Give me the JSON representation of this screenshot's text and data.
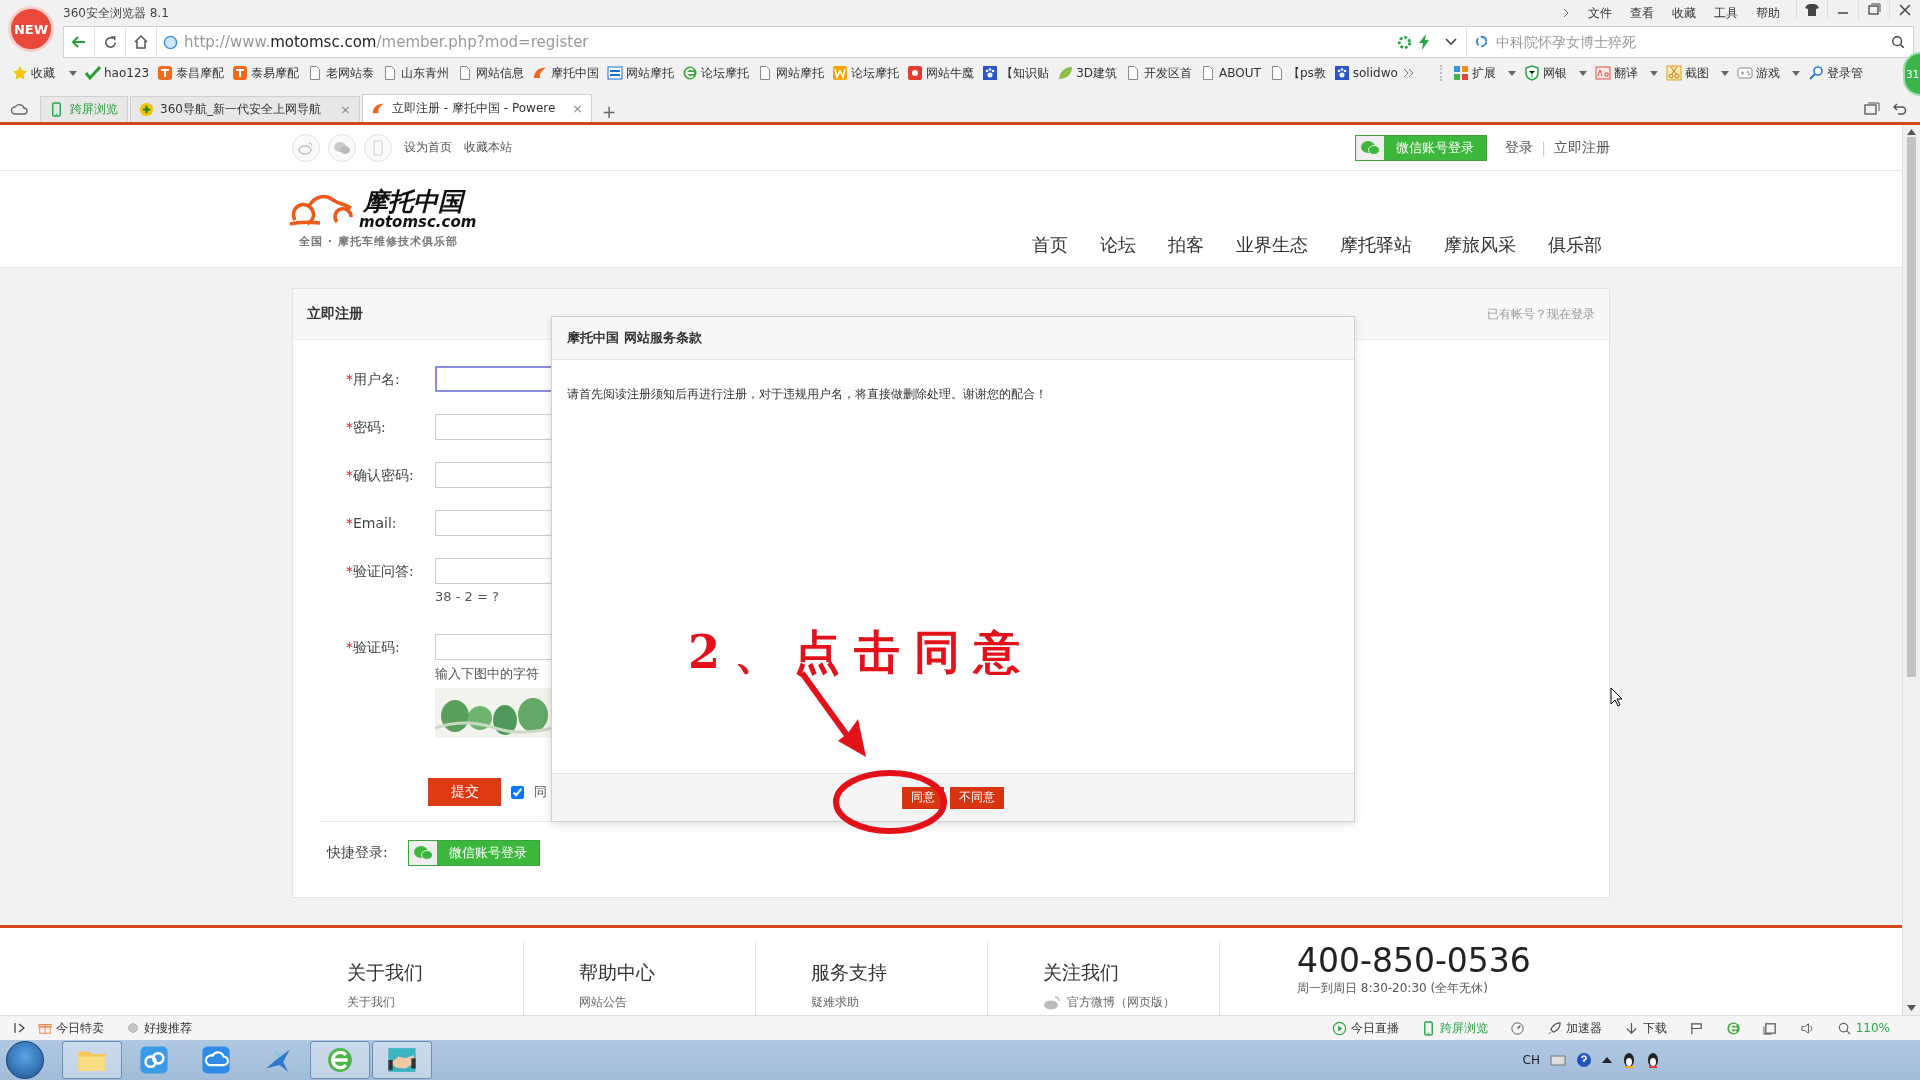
{
  "browser": {
    "badge": "NEW",
    "title": "360安全浏览器 8.1",
    "menu": [
      "文件",
      "查看",
      "收藏",
      "工具",
      "帮助"
    ],
    "url": {
      "prefix": "http://www.",
      "domain": "motomsc.com",
      "path": "/member.php?mod=register"
    },
    "search": {
      "placeholder": "中科院怀孕女博士猝死"
    },
    "bookmarks": [
      {
        "label": "收藏",
        "kind": "star",
        "caret": true
      },
      {
        "label": "hao123",
        "kind": "hao",
        "caret": false
      },
      {
        "label": "泰昌摩配",
        "kind": "tao",
        "caret": false
      },
      {
        "label": "泰易摩配",
        "kind": "tao",
        "caret": false
      },
      {
        "label": "老网站泰",
        "kind": "page",
        "caret": false
      },
      {
        "label": "山东青州",
        "kind": "page",
        "caret": false
      },
      {
        "label": "网站信息",
        "kind": "page",
        "caret": false
      },
      {
        "label": "摩托中国",
        "kind": "moto",
        "caret": false
      },
      {
        "label": "网站摩托",
        "kind": "mi",
        "caret": false
      },
      {
        "label": "论坛摩托",
        "kind": "ie",
        "caret": false
      },
      {
        "label": "网站摩托",
        "kind": "page",
        "caret": false
      },
      {
        "label": "论坛摩托",
        "kind": "w",
        "caret": false
      },
      {
        "label": "网站牛魔",
        "kind": "red",
        "caret": false
      },
      {
        "label": "【知识贴",
        "kind": "paw",
        "caret": false
      },
      {
        "label": "3D建筑",
        "kind": "leaf",
        "caret": false
      },
      {
        "label": "开发区首",
        "kind": "page",
        "caret": false
      },
      {
        "label": "ABOUT",
        "kind": "page",
        "caret": false
      },
      {
        "label": "【ps教",
        "kind": "page",
        "caret": false
      },
      {
        "label": "solidwo",
        "kind": "paw",
        "caret": false
      }
    ],
    "tools": [
      {
        "label": "扩展",
        "kind": "grid",
        "caret": true
      },
      {
        "label": "网银",
        "kind": "shield",
        "caret": true
      },
      {
        "label": "翻译",
        "kind": "translate",
        "caret": true
      },
      {
        "label": "截图",
        "kind": "scissors",
        "caret": true
      },
      {
        "label": "游戏",
        "kind": "game",
        "caret": true
      },
      {
        "label": "登录管",
        "kind": "key",
        "caret": false
      }
    ],
    "float_badge": "31",
    "tabs": [
      {
        "label": "跨屏浏览",
        "kind": "app",
        "selected": false
      },
      {
        "label": "360导航_新一代安全上网导航",
        "kind": "page",
        "selected": false,
        "close": "×"
      },
      {
        "label": "立即注册 - 摩托中国 - Powere",
        "kind": "page",
        "selected": true,
        "close": "×"
      }
    ],
    "new_tab": "+"
  },
  "site": {
    "top_links": [
      "设为首页",
      "收藏本站"
    ],
    "wechat_login": "微信账号登录",
    "login": "登录",
    "divider": "|",
    "register": "立即注册",
    "logo": {
      "name": "摩托中国",
      "domain": "motomsc.com",
      "tagline": "全国 · 摩托车维修技术俱乐部"
    },
    "nav": [
      "首页",
      "论坛",
      "拍客",
      "业界生态",
      "摩托驿站",
      "摩旅风采",
      "俱乐部"
    ],
    "card": {
      "title": "立即注册",
      "login_link": "已有帐号？现在登录",
      "fields": [
        {
          "mark": "*",
          "label": "用户名:",
          "focused": true
        },
        {
          "mark": "*",
          "label": "密码:",
          "focused": false
        },
        {
          "mark": "*",
          "label": "确认密码:",
          "focused": false
        },
        {
          "mark": "*",
          "label": "Email:",
          "focused": false
        },
        {
          "mark": "*",
          "label": "验证问答:",
          "focused": false,
          "hint": "38 - 2 = ?"
        },
        {
          "mark": "*",
          "label": "验证码:",
          "focused": false,
          "hint": "输入下图中的字符"
        }
      ],
      "submit": "提交",
      "agree": {
        "checked": true,
        "label": "同"
      },
      "quick_login": "快捷登录:",
      "quick_wechat": "微信账号登录"
    },
    "modal": {
      "title": "摩托中国 网站服务条款",
      "body": "请首先阅读注册须知后再进行注册，对于违规用户名，将直接做删除处理。谢谢您的配合！",
      "buttons": [
        "同意",
        "不同意"
      ]
    },
    "annotation": "2、点击同意",
    "footer": {
      "columns": [
        {
          "title": "关于我们",
          "link": "关于我们",
          "kind": "text"
        },
        {
          "title": "帮助中心",
          "link": "网站公告",
          "kind": "text"
        },
        {
          "title": "服务支持",
          "link": "疑难求助",
          "kind": "text"
        },
        {
          "title": "关注我们",
          "link": "官方微博（网页版）",
          "kind": "weibo"
        }
      ],
      "phone": "400-850-0536",
      "hours": "周一到周日 8:30-20:30 (全年无休)"
    }
  },
  "status_bar": {
    "left": [
      {
        "label": "今日特卖",
        "kind": "gift"
      },
      {
        "label": "好搜推荐",
        "kind": "dot"
      }
    ],
    "right": [
      {
        "label": "今日直播",
        "kind": "play",
        "green": false
      },
      {
        "label": "跨屏浏览",
        "kind": "phone",
        "green": true
      },
      {
        "kind": "speed"
      },
      {
        "label": "加速器",
        "kind": "rocket",
        "green": false
      },
      {
        "label": "下载",
        "kind": "down",
        "green": false
      },
      {
        "kind": "flag"
      },
      {
        "kind": "ie"
      },
      {
        "kind": "window"
      },
      {
        "kind": "speaker"
      },
      {
        "label": "110%",
        "kind": "zoom",
        "green": true
      }
    ]
  },
  "taskbar": {
    "apps": [
      {
        "kind": "folder",
        "active": true
      },
      {
        "kind": "cloud-a",
        "active": false
      },
      {
        "kind": "cloud-b",
        "active": false
      },
      {
        "kind": "bird",
        "active": false
      },
      {
        "kind": "browser",
        "active": true
      },
      {
        "kind": "handshake",
        "active": true
      }
    ],
    "tray_lang": "CH"
  }
}
